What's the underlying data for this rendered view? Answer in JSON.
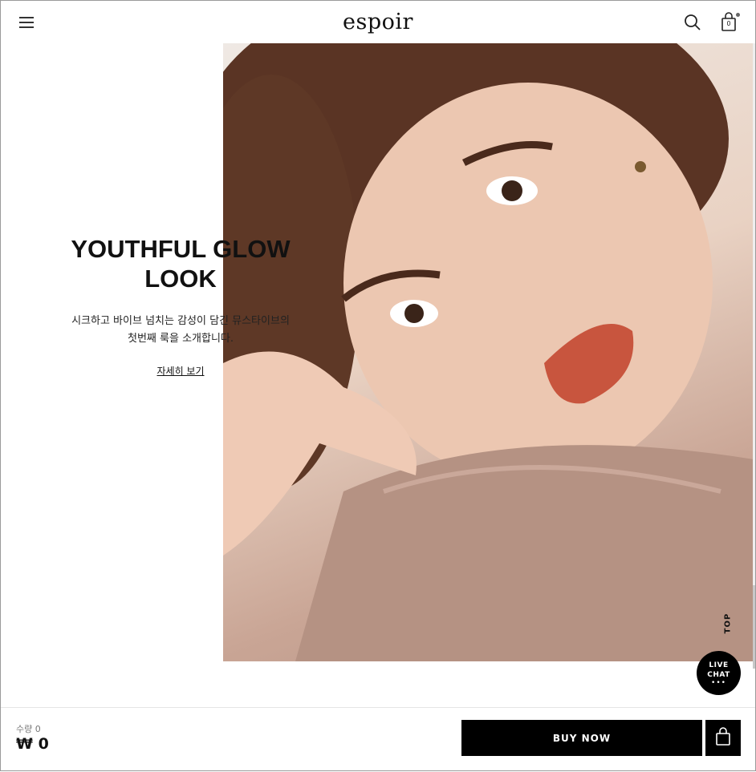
{
  "header": {
    "logo": "espoir",
    "cart_count": "0"
  },
  "hero": {
    "title_line1": "YOUTHFUL GLOW",
    "title_line2": "LOOK",
    "desc_line1": "시크하고 바이브 넘치는 감성이 담긴 뮤스타이브의",
    "desc_line2": "첫번째 룩을 소개합니다.",
    "link_label": "자세히 보기"
  },
  "floating": {
    "top_label": "TOP",
    "live_chat_line1": "LIVE",
    "live_chat_line2": "CHAT",
    "live_chat_dots": "•••"
  },
  "bottom_bar": {
    "quantity_label": "수량 0",
    "price": "₩ 0",
    "buy_now_label": "BUY NOW"
  },
  "icons": {
    "menu": "hamburger-menu-icon",
    "search": "search-icon",
    "cart": "shopping-bag-icon",
    "add_to_cart": "shopping-bag-icon"
  },
  "colors": {
    "primary": "#000000",
    "background": "#ffffff"
  }
}
